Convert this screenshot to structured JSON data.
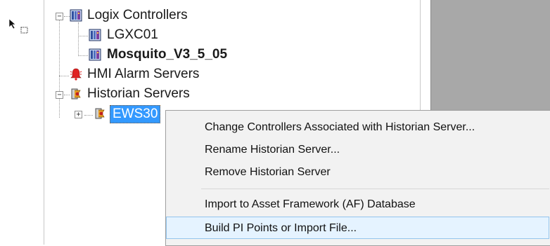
{
  "tree": {
    "logix_controllers": "Logix Controllers",
    "lgxc01": "LGXC01",
    "mosquito": "Mosquito_V3_5_05",
    "hmi_alarm_servers": "HMI Alarm Servers",
    "historian_servers": "Historian Servers",
    "ews30": "EWS30",
    "expand_symbol_minus": "−",
    "expand_symbol_plus": "+"
  },
  "context_menu": {
    "items": [
      "Change Controllers Associated with Historian Server...",
      "Rename Historian Server...",
      "Remove Historian Server",
      "Import to Asset Framework (AF) Database",
      "Build PI Points or Import File..."
    ],
    "hovered_index": 4
  },
  "icons": {
    "cursor": "arrow-drag-cursor-icon",
    "controller": "controller-chassis-icon",
    "alarm": "alarm-bell-icon",
    "historian": "historian-server-icon"
  },
  "colors": {
    "selection": "#3399ff",
    "menu_background": "#f2f2f2",
    "menu_hover": "#e5f3ff",
    "gray_panel": "#a8a8a8"
  }
}
